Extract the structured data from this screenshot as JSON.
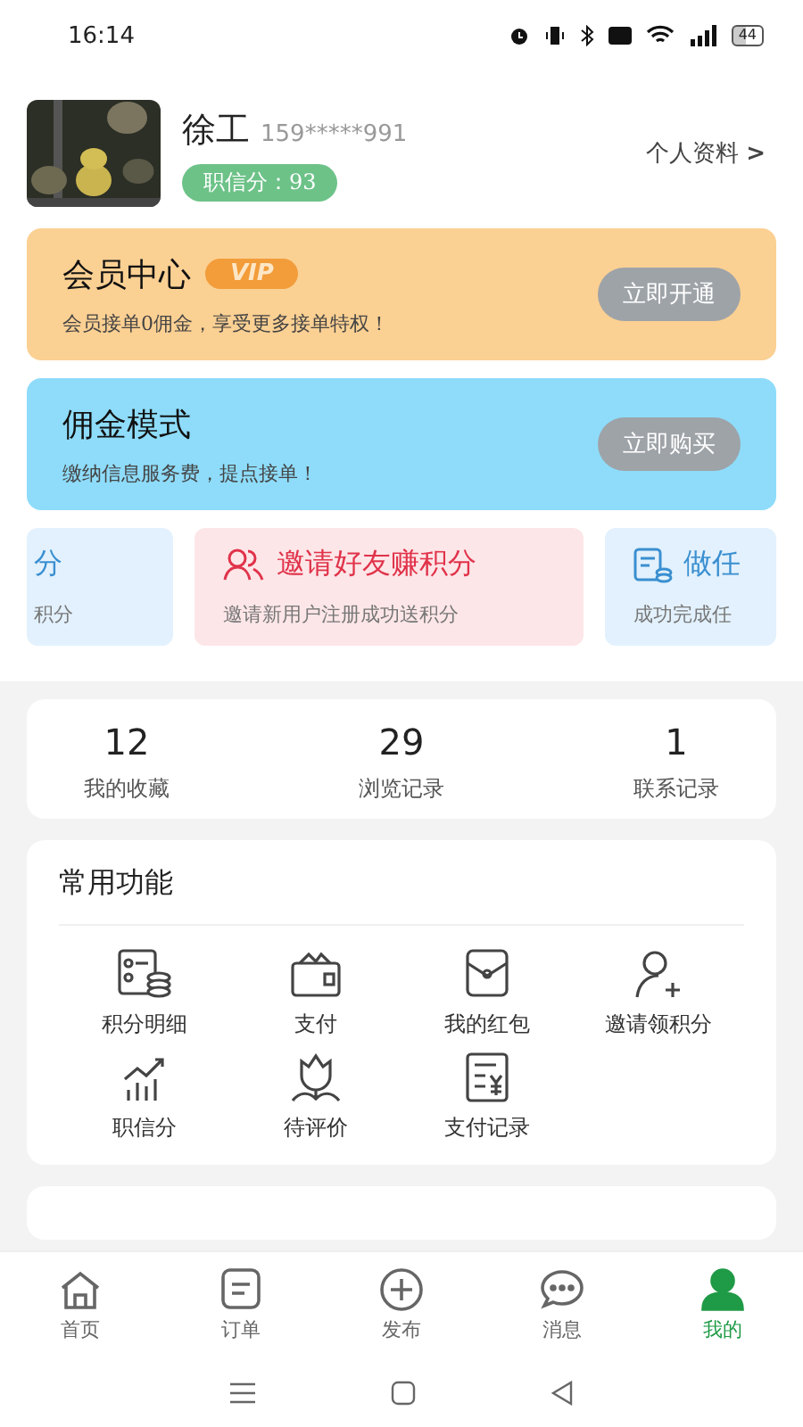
{
  "status_bar": {
    "time": "16:14",
    "battery": "44"
  },
  "profile": {
    "name": "徐工",
    "phone": "159*****991",
    "score_badge": "职信分：93",
    "link": "个人资料",
    "link_arrow": ">"
  },
  "banners": [
    {
      "kind": "vip",
      "title": "会员中心",
      "badge": "VIP",
      "subtitle": "会员接单0佣金，享受更多接单特权！",
      "button": "立即开通"
    },
    {
      "kind": "commission",
      "title": "佣金模式",
      "subtitle": "缴纳信息服务费，提点接单！",
      "button": "立即购买"
    }
  ],
  "promos": [
    {
      "kind": "cut-left",
      "title": "分",
      "subtitle": "积分"
    },
    {
      "kind": "invite",
      "title": "邀请好友赚积分",
      "subtitle": "邀请新用户注册成功送积分"
    },
    {
      "kind": "task",
      "title": "做任",
      "subtitle": "成功完成任"
    }
  ],
  "stats": [
    {
      "value": "12",
      "label": "我的收藏"
    },
    {
      "value": "29",
      "label": "浏览记录"
    },
    {
      "value": "1",
      "label": "联系记录"
    }
  ],
  "functions": {
    "title": "常用功能",
    "items": [
      {
        "kind": "points",
        "label": "积分明细"
      },
      {
        "kind": "wallet",
        "label": "支付"
      },
      {
        "kind": "envelope",
        "label": "我的红包"
      },
      {
        "kind": "invite",
        "label": "邀请领积分"
      },
      {
        "kind": "chart",
        "label": "职信分"
      },
      {
        "kind": "flower",
        "label": "待评价"
      },
      {
        "kind": "bill",
        "label": "支付记录"
      }
    ]
  },
  "tabs": [
    {
      "kind": "home",
      "label": "首页",
      "selected": false
    },
    {
      "kind": "orders",
      "label": "订单",
      "selected": false
    },
    {
      "kind": "publish",
      "label": "发布",
      "selected": false
    },
    {
      "kind": "messages",
      "label": "消息",
      "selected": false
    },
    {
      "kind": "me",
      "label": "我的",
      "selected": true
    }
  ]
}
